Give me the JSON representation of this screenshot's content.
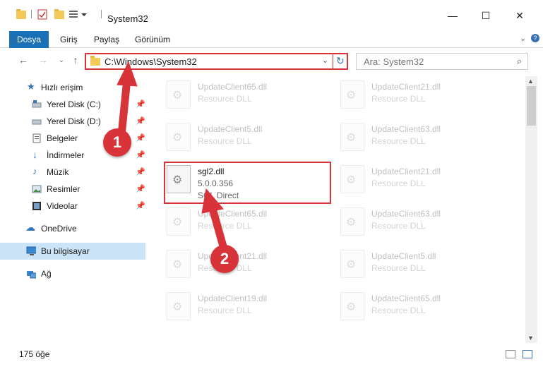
{
  "window": {
    "title": "System32",
    "minimize_icon": "minimize-icon",
    "maximize_icon": "maximize-icon",
    "close_icon": "close-icon"
  },
  "ribbon": {
    "tabs": [
      {
        "label": "Dosya",
        "active": true
      },
      {
        "label": "Giriş"
      },
      {
        "label": "Paylaş"
      },
      {
        "label": "Görünüm"
      }
    ],
    "accent": "#1a6fb5"
  },
  "address": {
    "path": "C:\\Windows\\System32",
    "search_placeholder": "Ara: System32"
  },
  "sidebar": {
    "quick_access": "Hızlı erişim",
    "items": [
      {
        "label": "Yerel Disk (C:)",
        "icon": "drive-icon"
      },
      {
        "label": "Yerel Disk (D:)",
        "icon": "drive-icon"
      },
      {
        "label": "Belgeler",
        "icon": "documents-icon"
      },
      {
        "label": "İndirmeler",
        "icon": "downloads-icon"
      },
      {
        "label": "Müzik",
        "icon": "music-icon"
      },
      {
        "label": "Resimler",
        "icon": "pictures-icon"
      },
      {
        "label": "Videolar",
        "icon": "videos-icon"
      }
    ],
    "onedrive": "OneDrive",
    "this_pc": "Bu bilgisayar",
    "network": "Ağ"
  },
  "files": {
    "left": [
      {
        "name": "UpdateClient65.dll",
        "desc": "Resource DLL"
      },
      {
        "name": "UpdateClient5.dll",
        "desc": "Resource DLL"
      },
      {
        "name": "UpdateClient65.dll",
        "desc": "Resource DLL"
      },
      {
        "name": "UpdateClient21.dll",
        "desc": "Resource DLL"
      },
      {
        "name": "UpdateClient19.dll",
        "desc": "Resource DLL"
      }
    ],
    "right": [
      {
        "name": "UpdateClient21.dll",
        "desc": "Resource DLL"
      },
      {
        "name": "UpdateClient63.dll",
        "desc": "Resource DLL"
      },
      {
        "name": "UpdateClient21.dll",
        "desc": "Resource DLL"
      },
      {
        "name": "UpdateClient63.dll",
        "desc": "Resource DLL"
      },
      {
        "name": "UpdateClient5.dll",
        "desc": "Resource DLL"
      },
      {
        "name": "UpdateClient65.dll",
        "desc": "Resource DLL"
      }
    ],
    "highlighted": {
      "name": "sgl2.dll",
      "version": "5.0.0.356",
      "desc": "SGL Direct"
    }
  },
  "status": {
    "count": "175 öğe"
  },
  "annotations": {
    "step1": "1",
    "step2": "2",
    "color": "#d9333a"
  }
}
